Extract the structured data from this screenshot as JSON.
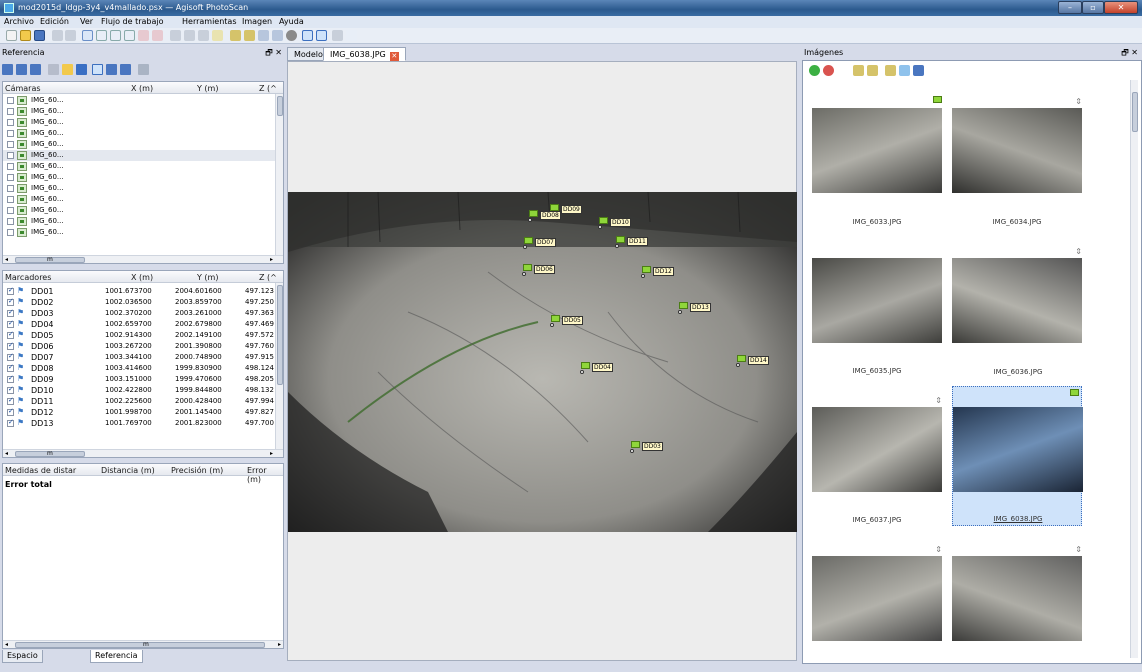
{
  "window": {
    "title": "mod2015d_ldgp-3y4_v4mallado.psx — Agisoft PhotoScan",
    "btn_min": "–",
    "btn_max": "▫",
    "btn_close": "✕"
  },
  "menu": [
    "Archivo",
    "Edición",
    "Ver",
    "Flujo de trabajo",
    "Herramientas",
    "Imagen",
    "Ayuda"
  ],
  "reference_panel": {
    "title": "Referencia",
    "pin": "🗗 ✕",
    "cameras": {
      "headers": [
        "Cámaras",
        "X (m)",
        "Y (m)",
        "Z (^"
      ],
      "rows": [
        "IMG_60...",
        "IMG_60...",
        "IMG_60...",
        "IMG_60...",
        "IMG_60...",
        "IMG_60...",
        "IMG_60...",
        "IMG_60...",
        "IMG_60...",
        "IMG_60...",
        "IMG_60...",
        "IMG_60...",
        "IMG_60..."
      ],
      "scroll_left": "◂",
      "scroll_right": "▸",
      "scroll_grip": "m"
    },
    "markers": {
      "headers": [
        "Marcadores",
        "X (m)",
        "Y (m)",
        "Z (^"
      ],
      "rows": [
        {
          "name": "DD01",
          "x": "1001.673700",
          "y": "2004.601600",
          "z": "497.123"
        },
        {
          "name": "DD02",
          "x": "1002.036500",
          "y": "2003.859700",
          "z": "497.250"
        },
        {
          "name": "DD03",
          "x": "1002.370200",
          "y": "2003.261000",
          "z": "497.363"
        },
        {
          "name": "DD04",
          "x": "1002.659700",
          "y": "2002.679800",
          "z": "497.469"
        },
        {
          "name": "DD05",
          "x": "1002.914300",
          "y": "2002.149100",
          "z": "497.572"
        },
        {
          "name": "DD06",
          "x": "1003.267200",
          "y": "2001.390800",
          "z": "497.760"
        },
        {
          "name": "DD07",
          "x": "1003.344100",
          "y": "2000.748900",
          "z": "497.915"
        },
        {
          "name": "DD08",
          "x": "1003.414600",
          "y": "1999.830900",
          "z": "498.124"
        },
        {
          "name": "DD09",
          "x": "1003.151000",
          "y": "1999.470600",
          "z": "498.205"
        },
        {
          "name": "DD10",
          "x": "1002.422800",
          "y": "1999.844800",
          "z": "498.132"
        },
        {
          "name": "DD11",
          "x": "1002.225600",
          "y": "2000.428400",
          "z": "497.994"
        },
        {
          "name": "DD12",
          "x": "1001.998700",
          "y": "2001.145400",
          "z": "497.827"
        },
        {
          "name": "DD13",
          "x": "1001.769700",
          "y": "2001.823000",
          "z": "497.700"
        }
      ],
      "scroll_left": "◂",
      "scroll_right": "▸",
      "scroll_grip": "m"
    },
    "distances": {
      "headers": [
        "Medidas de distar",
        "Distancia (m)",
        "Precisión (m)",
        "Error (m)"
      ],
      "total_label": "Error total",
      "scroll_left": "◂",
      "scroll_right": "▸",
      "scroll_grip": "m"
    },
    "bottom_tabs": [
      "Espacio de trabajo",
      "Referencia"
    ]
  },
  "document_tabs": {
    "tabs": [
      "Modelo",
      "IMG_6038.JPG"
    ],
    "close_glyph": "✕",
    "pin": "🗗 ✕"
  },
  "photo_markers": [
    {
      "label": "DD09"
    },
    {
      "label": "DD08"
    },
    {
      "label": "DD10"
    },
    {
      "label": "DD07"
    },
    {
      "label": "DD11"
    },
    {
      "label": "DD06"
    },
    {
      "label": "DD12"
    },
    {
      "label": "DD13"
    },
    {
      "label": "DD05"
    },
    {
      "label": "DD14"
    },
    {
      "label": "DD04"
    },
    {
      "label": "DD03"
    }
  ],
  "images_panel": {
    "title": "Imágenes",
    "pin": "🗗 ✕",
    "pin_glyph": "⇕",
    "thumbnails": [
      {
        "name": ""
      },
      {
        "name": ""
      },
      {
        "name": "IMG_6033.JPG"
      },
      {
        "name": "IMG_6034.JPG"
      },
      {
        "name": "IMG_6035.JPG"
      },
      {
        "name": "IMG_6036.JPG"
      },
      {
        "name": "IMG_6037.JPG"
      },
      {
        "name": "IMG_6038.JPG"
      },
      {
        "name": ""
      },
      {
        "name": ""
      }
    ]
  },
  "colors": {
    "title_gradient_top": "#5b86b8",
    "marker_flag": "#8fd63a",
    "marker_label_bg": "#fff8c8",
    "selected_thumb": "#cfe3fa"
  }
}
